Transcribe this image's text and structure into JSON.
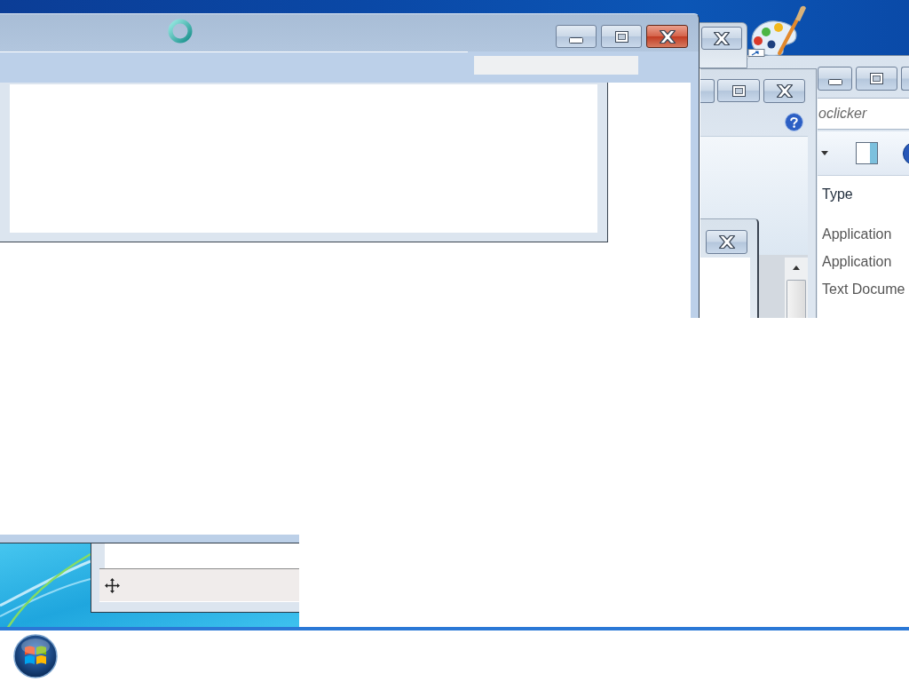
{
  "windows": [
    {
      "kind": "main",
      "active": true
    },
    {
      "kind": "backdrop",
      "active": false
    },
    {
      "kind": "dialog",
      "active": false
    },
    {
      "kind": "popup",
      "active": false
    },
    {
      "kind": "explorer",
      "active": false,
      "address": "oclicker",
      "columns": [
        "Type"
      ],
      "rows": [
        {
          "type": "Application"
        },
        {
          "type": "Application"
        },
        {
          "type": "Text Docume"
        }
      ]
    }
  ]
}
